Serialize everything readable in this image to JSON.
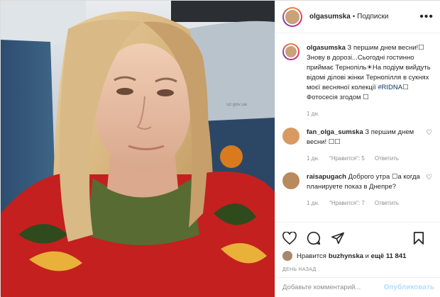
{
  "post": {
    "image_alt": "Фото",
    "author": "olgasumska",
    "dot": "•",
    "follow_label": "Подписки",
    "more_label": "•••"
  },
  "caption": {
    "user": "olgasumska",
    "text_before": " З першим днем весни!☐ Знову в дорозі...Сьогодні гостинно приймає Тернопіль☀На подіум вийдуть відомі ділові жінки Тернопілля в сукнях моєї весняної колекції ",
    "hashtag": "#RIDNA",
    "text_after": "☐ Фотосесія згодом ☐",
    "time": "1 дн."
  },
  "comments": [
    {
      "user": "fan_olga_sumska",
      "text": " З першим днем весни! ☐☐",
      "time": "1 дн.",
      "likes": "\"Нравится\": 5",
      "reply": "Ответить"
    },
    {
      "user": "raisapugach",
      "text": " Доброго утра ☐а когда планируете показ в Днепре?",
      "time": "1 дн.",
      "likes": "\"Нравится\": 7",
      "reply": "Ответить"
    }
  ],
  "likes": {
    "prefix": "Нравится ",
    "user": "buzhynska",
    "middle": " и ",
    "count": "ещё 11 841"
  },
  "ago": "ДЕНЬ НАЗАД",
  "add_comment": {
    "placeholder": "Добавьте комментарий...",
    "publish": "Опубликовать"
  },
  "colors": {
    "accent": "#0095f6",
    "publish_disabled": "#b2dffc",
    "hashtag": "#00376b"
  },
  "icons": [
    "heart-icon",
    "comment-icon",
    "share-icon",
    "bookmark-icon",
    "more-icon"
  ]
}
